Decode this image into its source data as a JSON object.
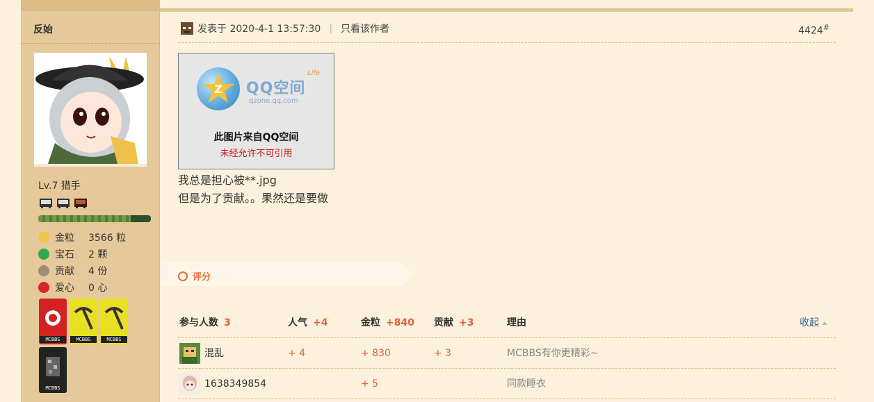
{
  "profile": {
    "username": "反始",
    "level": "Lv.7 猎手",
    "level_progress": 0.82,
    "stats": [
      {
        "icon": "gold-nugget-icon",
        "label": "金粒",
        "value": "3566 粒",
        "color": "#e9c84a"
      },
      {
        "icon": "emerald-icon",
        "label": "宝石",
        "value": "2 颗",
        "color": "#2fa84f"
      },
      {
        "icon": "contribution-icon",
        "label": "贡献",
        "value": "4 份",
        "color": "#a08a78"
      },
      {
        "icon": "apple-heart-icon",
        "label": "爱心",
        "value": "0 心",
        "color": "#d8242a"
      }
    ],
    "medal_tag": "MCBBS"
  },
  "post": {
    "posted_label": "发表于 2020-4-1 13:57:30",
    "only_author": "只看该作者",
    "floor": "4424",
    "floor_mark": "#",
    "image": {
      "logo_text": "QQ空间",
      "logo_sub": "qzone.qq.com",
      "logo_life": "Life",
      "line1": "此图片来自QQ空间",
      "line2": "未经允许不可引用"
    },
    "lines": [
      "我总是担心被**.jpg",
      "但是为了贡献。。果然还是要做"
    ]
  },
  "rating": {
    "label": "评分",
    "header": {
      "participants_label": "参与人数",
      "participants": "3",
      "popularity_label": "人气",
      "popularity": "+4",
      "gold_label": "金粒",
      "gold": "+840",
      "contribution_label": "贡献",
      "contribution": "+3",
      "reason_label": "理由",
      "collapse": "收起"
    },
    "rows": [
      {
        "user": "混乱",
        "popularity": "+ 4",
        "gold": "+ 830",
        "contribution": "+ 3",
        "reason": "MCBBS有你更精彩~"
      },
      {
        "user": "1638349854",
        "popularity": "",
        "gold": "+ 5",
        "contribution": "",
        "reason": "同款睡衣"
      }
    ]
  }
}
